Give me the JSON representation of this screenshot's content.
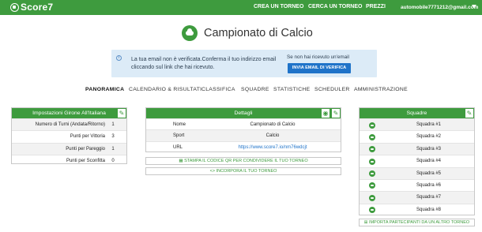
{
  "header": {
    "brand": "Score7",
    "nav": [
      "CREA UN TORNEO",
      "CERCA UN TORNEO",
      "PREZZI"
    ],
    "user_email": "automobile7771212@gmail.com"
  },
  "page": {
    "title": "Campionato di Calcio"
  },
  "notice": {
    "message": "La tua email non è verificata.Conferma il tuo indirizzo email cliccando sul link che hai ricevuto.",
    "side_text": "Se non hai ricevuto un'email",
    "button_label": "INVIA EMAIL DI VERIFICA"
  },
  "tabs": [
    "PANORAMICA",
    "CALENDARIO & RISULTATI",
    "CLASSIFICA",
    "SQUADRE",
    "STATISTICHE",
    "SCHEDULER",
    "AMMINISTRAZIONE"
  ],
  "settings": {
    "title": "Impostazioni Girone All'Italiana",
    "rows": [
      {
        "label": "Numero di Turni (Andata/Ritorno)",
        "value": "1"
      },
      {
        "label": "Punti per Vittoria",
        "value": "3"
      },
      {
        "label": "Punti per Pareggio",
        "value": "1"
      },
      {
        "label": "Punti per Sconfitta",
        "value": "0"
      }
    ]
  },
  "details": {
    "title": "Dettagli",
    "rows": [
      {
        "key": "Nome",
        "value": "Campionato di Calcio"
      },
      {
        "key": "Sport",
        "value": "Calcio"
      },
      {
        "key": "URL",
        "value": "https://www.score7.io/nm76wdcjt"
      }
    ],
    "qr_button": "STAMPA IL CODICE QR PER CONDIVIDERE IL TUO TORNEO",
    "embed_button": "INCORPORA IL TUO TORNEO"
  },
  "teams": {
    "title": "Squadre",
    "items": [
      "Squadra #1",
      "Squadra #2",
      "Squadra #3",
      "Squadra #4",
      "Squadra #5",
      "Squadra #6",
      "Squadra #7",
      "Squadra #8"
    ],
    "import_button": "IMPORTA PARTECIPANTI DA UN ALTRO TORNEO"
  },
  "icons": {
    "brand": "trophy-icon",
    "title": "cloud-upload-icon",
    "info": "info-icon",
    "edit": "pencil-icon",
    "palette": "palette-icon",
    "qr": "qr-code-icon",
    "embed": "code-icon",
    "team": "cloud-icon",
    "caret": "caret-down-icon"
  },
  "colors": {
    "brand_green": "#3e9b3e",
    "notice_bg": "#dcebf7",
    "verify_button": "#1f73c9"
  }
}
